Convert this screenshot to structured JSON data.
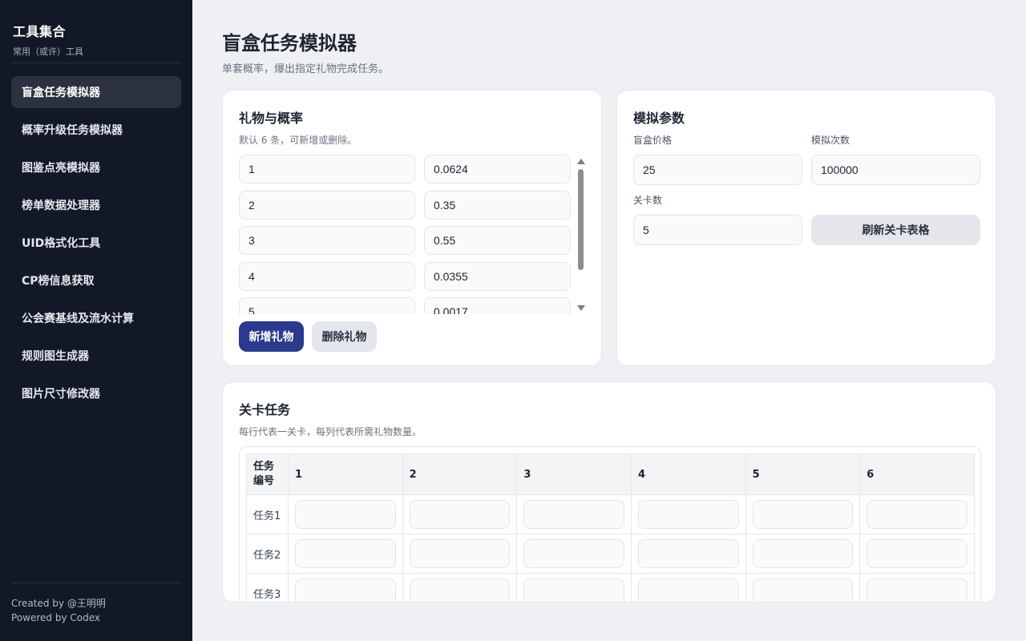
{
  "sidebar": {
    "title": "工具集合",
    "subtitle": "常用（或许）工具",
    "items": [
      {
        "label": "盲盒任务模拟器",
        "active": true
      },
      {
        "label": "概率升级任务模拟器"
      },
      {
        "label": "图鉴点亮模拟器"
      },
      {
        "label": "榜单数据处理器"
      },
      {
        "label": "UID格式化工具"
      },
      {
        "label": "CP榜信息获取"
      },
      {
        "label": "公会赛基线及流水计算"
      },
      {
        "label": "规则图生成器"
      },
      {
        "label": "图片尺寸修改器"
      }
    ],
    "footer": {
      "created_by": "Created by @王明明",
      "powered_by": "Powered by Codex"
    }
  },
  "page": {
    "title": "盲盒任务模拟器",
    "subtitle": "单套概率，爆出指定礼物完成任务。"
  },
  "gifts": {
    "title": "礼物与概率",
    "hint": "默认 6 条，可新增或删除。",
    "rows": [
      {
        "name": "1",
        "prob": "0.0624"
      },
      {
        "name": "2",
        "prob": "0.35"
      },
      {
        "name": "3",
        "prob": "0.55"
      },
      {
        "name": "4",
        "prob": "0.0355"
      },
      {
        "name": "5",
        "prob": "0.0017"
      }
    ],
    "add_label": "新增礼物",
    "delete_label": "删除礼物"
  },
  "params": {
    "title": "模拟参数",
    "price_label": "盲盒价格",
    "price_value": "25",
    "runs_label": "模拟次数",
    "runs_value": "100000",
    "levels_label": "关卡数",
    "levels_value": "5",
    "refresh_label": "刷新关卡表格"
  },
  "levels": {
    "title": "关卡任务",
    "hint": "每行代表一关卡，每列代表所需礼物数量。",
    "id_header_line1": "任务",
    "id_header_line2": "编号",
    "columns": [
      "1",
      "2",
      "3",
      "4",
      "5",
      "6"
    ],
    "rows": [
      "任务1",
      "任务2",
      "任务3"
    ]
  },
  "colors": {
    "sidebar_bg": "#121826",
    "primary": "#2b3a8c",
    "page_bg": "#eef0f4"
  }
}
